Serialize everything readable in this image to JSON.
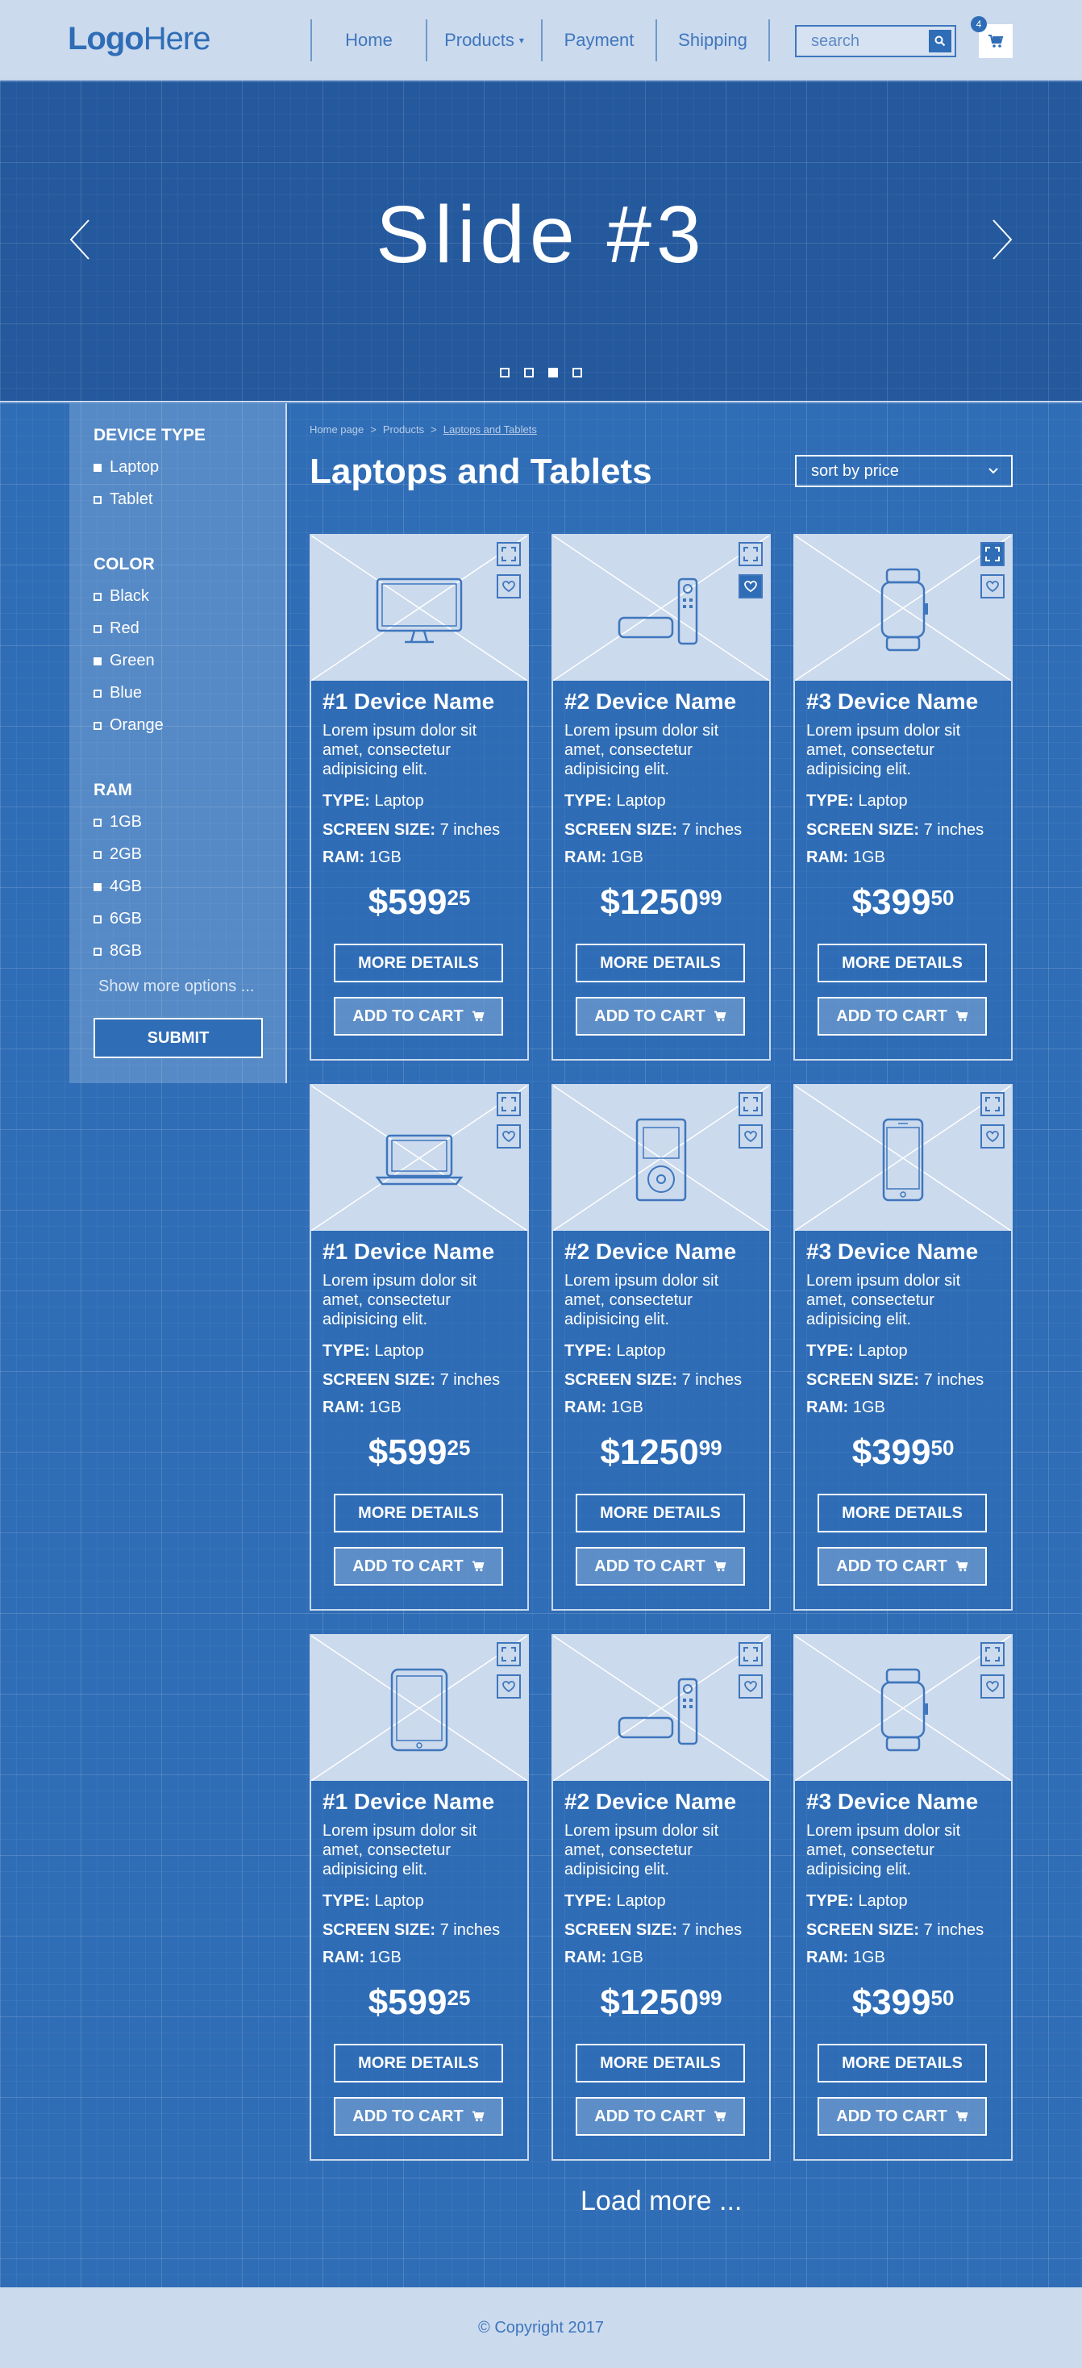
{
  "header": {
    "logo_bold": "Logo",
    "logo_light": "Here",
    "nav": [
      {
        "label": "Home"
      },
      {
        "label": "Products"
      },
      {
        "label": "Payment"
      },
      {
        "label": "Shipping"
      }
    ],
    "search_placeholder": "search",
    "cart_count": "4"
  },
  "hero": {
    "title": "Slide #3",
    "dots": 4,
    "active_dot": 3
  },
  "filters": {
    "device_type": {
      "title": "DEVICE TYPE",
      "options": [
        {
          "label": "Laptop",
          "checked": true
        },
        {
          "label": "Tablet",
          "checked": false
        }
      ]
    },
    "color": {
      "title": "COLOR",
      "options": [
        {
          "label": "Black",
          "checked": false
        },
        {
          "label": "Red",
          "checked": false
        },
        {
          "label": "Green",
          "checked": true
        },
        {
          "label": "Blue",
          "checked": false
        },
        {
          "label": "Orange",
          "checked": false
        }
      ]
    },
    "ram": {
      "title": "RAM",
      "options": [
        {
          "label": "1GB",
          "checked": false
        },
        {
          "label": "2GB",
          "checked": false
        },
        {
          "label": "4GB",
          "checked": true
        },
        {
          "label": "6GB",
          "checked": false
        },
        {
          "label": "8GB",
          "checked": false
        }
      ]
    },
    "show_more": "Show more options ...",
    "submit": "SUBMIT"
  },
  "breadcrumb": {
    "home": "Home page",
    "products": "Products",
    "current": "Laptops and Tablets",
    "sep": ">"
  },
  "page_title": "Laptops and Tablets",
  "sort_label": "sort by price",
  "product_labels": {
    "type": "TYPE:",
    "screen": "SCREEN SIZE:",
    "ram": "RAM:",
    "details": "MORE DETAILS",
    "cart": "ADD TO CART"
  },
  "products": [
    {
      "name": "#1 Device Name",
      "desc": "Lorem ipsum dolor sit amet, consectetur adipisicing elit.",
      "type": "Laptop",
      "screen": "7 inches",
      "ram": "1GB",
      "price_main": "$599",
      "price_cents": "25",
      "icon": "monitor-icon",
      "fav_active": false,
      "expand_active": false
    },
    {
      "name": "#2 Device Name",
      "desc": "Lorem ipsum dolor sit amet, consectetur adipisicing elit.",
      "type": "Laptop",
      "screen": "7 inches",
      "ram": "1GB",
      "price_main": "$1250",
      "price_cents": "99",
      "icon": "tv-box-icon",
      "fav_active": true,
      "expand_active": false
    },
    {
      "name": "#3 Device Name",
      "desc": "Lorem ipsum dolor sit amet, consectetur adipisicing elit.",
      "type": "Laptop",
      "screen": "7 inches",
      "ram": "1GB",
      "price_main": "$399",
      "price_cents": "50",
      "icon": "watch-icon",
      "fav_active": false,
      "expand_active": true
    },
    {
      "name": "#1 Device Name",
      "desc": "Lorem ipsum dolor sit amet, consectetur adipisicing elit.",
      "type": "Laptop",
      "screen": "7 inches",
      "ram": "1GB",
      "price_main": "$599",
      "price_cents": "25",
      "icon": "laptop-icon",
      "fav_active": false,
      "expand_active": false
    },
    {
      "name": "#2 Device Name",
      "desc": "Lorem ipsum dolor sit amet, consectetur adipisicing elit.",
      "type": "Laptop",
      "screen": "7 inches",
      "ram": "1GB",
      "price_main": "$1250",
      "price_cents": "99",
      "icon": "ipod-icon",
      "fav_active": false,
      "expand_active": false
    },
    {
      "name": "#3 Device Name",
      "desc": "Lorem ipsum dolor sit amet, consectetur adipisicing elit.",
      "type": "Laptop",
      "screen": "7 inches",
      "ram": "1GB",
      "price_main": "$399",
      "price_cents": "50",
      "icon": "phone-icon",
      "fav_active": false,
      "expand_active": false
    },
    {
      "name": "#1 Device Name",
      "desc": "Lorem ipsum dolor sit amet, consectetur adipisicing elit.",
      "type": "Laptop",
      "screen": "7 inches",
      "ram": "1GB",
      "price_main": "$599",
      "price_cents": "25",
      "icon": "tablet-icon",
      "fav_active": false,
      "expand_active": false
    },
    {
      "name": "#2 Device Name",
      "desc": "Lorem ipsum dolor sit amet, consectetur adipisicing elit.",
      "type": "Laptop",
      "screen": "7 inches",
      "ram": "1GB",
      "price_main": "$1250",
      "price_cents": "99",
      "icon": "tv-box-icon",
      "fav_active": false,
      "expand_active": false
    },
    {
      "name": "#3 Device Name",
      "desc": "Lorem ipsum dolor sit amet, consectetur adipisicing elit.",
      "type": "Laptop",
      "screen": "7 inches",
      "ram": "1GB",
      "price_main": "$399",
      "price_cents": "50",
      "icon": "watch-icon",
      "fav_active": false,
      "expand_active": false
    }
  ],
  "load_more": "Load more ...",
  "footer": "© Copyright 2017",
  "colors": {
    "primary": "#2f6db6",
    "light": "#cbdaed",
    "dark": "#25599d"
  }
}
